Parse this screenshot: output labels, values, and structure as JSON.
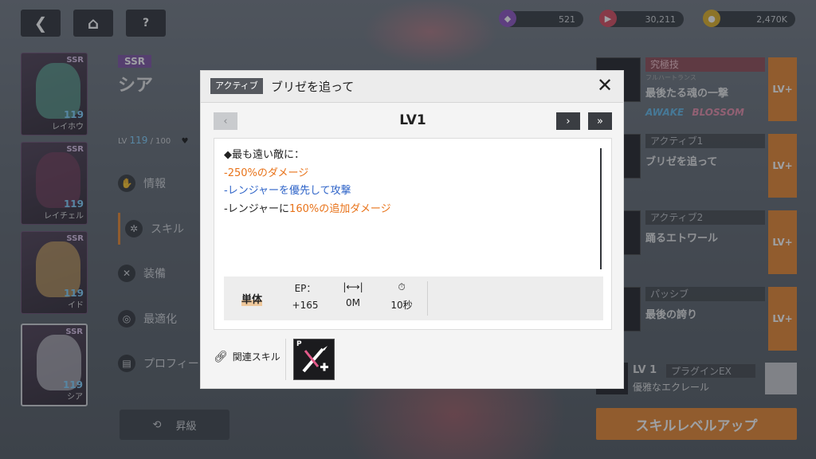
{
  "top_bar": {
    "currencies": [
      {
        "icon": "gem-icon",
        "value": "521",
        "color": "#8a4fc0"
      },
      {
        "icon": "ticket-icon",
        "value": "30,211",
        "color": "#d6455a"
      },
      {
        "icon": "credit-coin-icon",
        "value": "2,470K",
        "color": "#e0b020"
      }
    ]
  },
  "character": {
    "rarity": "SSR",
    "name": "シア",
    "lv_prefix": "LV",
    "level": "119",
    "level_max": "/ 100"
  },
  "roster": [
    {
      "rank": "SSR",
      "level": "119",
      "name": "レイホウ"
    },
    {
      "rank": "SSR",
      "level": "119",
      "name": "レイチェル"
    },
    {
      "rank": "SSR",
      "level": "119",
      "name": "イド"
    },
    {
      "rank": "SSR",
      "level": "119",
      "name": "シア"
    }
  ],
  "side_menu": [
    {
      "label": "情報"
    },
    {
      "label": "スキル"
    },
    {
      "label": "装備"
    },
    {
      "label": "最適化"
    },
    {
      "label": "プロフィー"
    }
  ],
  "promote_label": "昇級",
  "skills_panel": {
    "ultimate": {
      "type": "究極技",
      "subtitle": "フルハートランス",
      "name": "最後たる魂の一撃",
      "tag1": "AWAKE",
      "tag2": "BLOSSOM"
    },
    "active1": {
      "type": "アクティブ1",
      "name": "ブリゼを追って"
    },
    "active2": {
      "type": "アクティブ2",
      "name": "踊るエトワール"
    },
    "passive": {
      "type": "パッシブ",
      "name": "最後の誇り"
    },
    "plugin": {
      "level": "LV 1",
      "type": "プラグインEX",
      "name": "優雅なエクレール"
    },
    "lv_plus": "LV+",
    "level_up_label": "スキルレベルアップ"
  },
  "modal": {
    "type_badge": "アクティブ",
    "title": "ブリゼを追って",
    "level": "LV1",
    "description": {
      "line1": "◆最も遠い敵に：",
      "line2_prefix": "-",
      "line2_highlight": "250%のダメージ",
      "line3_prefix": "-",
      "line3_highlight": "レンジャーを優先して攻撃",
      "line4_prefix": "-レンジャーに",
      "line4_highlight": "160%の追加ダメージ"
    },
    "stats": {
      "target": "単体",
      "ep_label": "EP：",
      "ep_value": "+165",
      "range_value": "0M",
      "cooldown_value": "10秒"
    },
    "related_label": "関連スキル",
    "related_skill_tag": "P"
  },
  "colors": {
    "accent_orange": "#e8731a",
    "accent_blue": "#2f64c8",
    "button_orange": "#e8832a"
  }
}
